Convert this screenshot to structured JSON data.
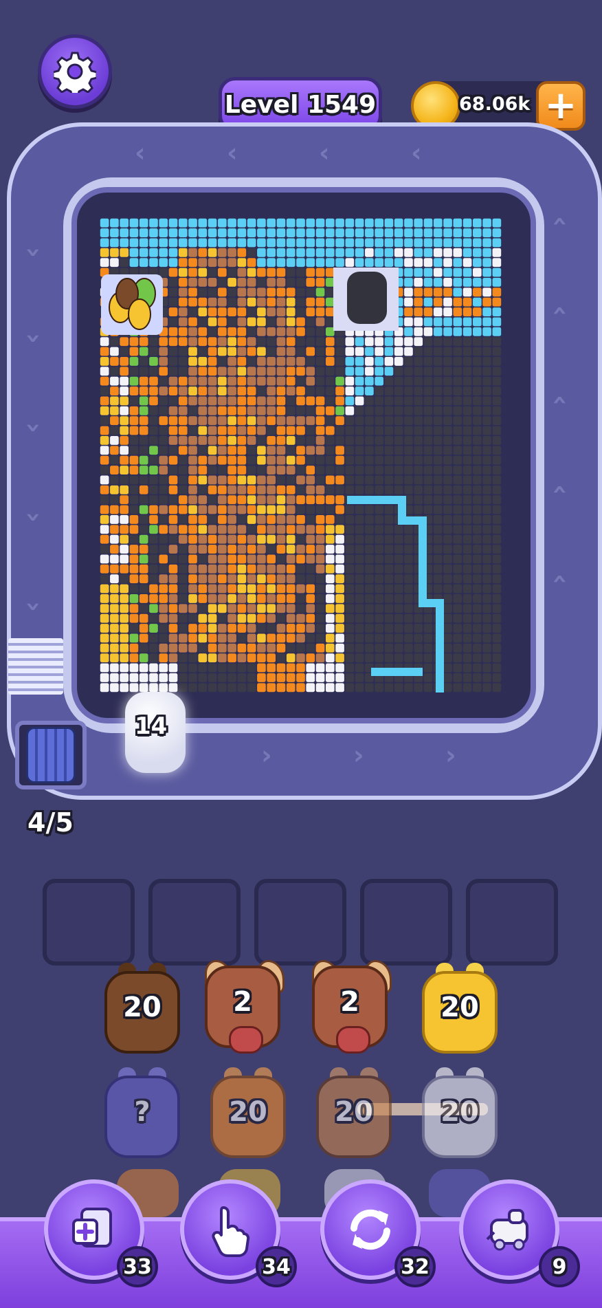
{
  "header": {
    "level_label": "Level 1549",
    "coins": "68.06k"
  },
  "conveyor": {
    "capacity": "4/5",
    "active_collector_count": "14"
  },
  "queue": {
    "row1": [
      {
        "count": "20",
        "color": "#7a4a2a",
        "kind": "pig"
      },
      {
        "count": "2",
        "color": "#a85d42",
        "kind": "bull"
      },
      {
        "count": "2",
        "color": "#a85d42",
        "kind": "bull"
      },
      {
        "count": "20",
        "color": "#f6c430",
        "kind": "pig"
      }
    ],
    "row2": [
      {
        "count": "?",
        "color": "#6a63c9",
        "kind": "pig"
      },
      {
        "count": "20",
        "color": "#f08a2a",
        "kind": "pig"
      },
      {
        "count": "20",
        "color": "#c7834e",
        "kind": "pig"
      },
      {
        "count": "20",
        "color": "#f2f2f8",
        "kind": "pig"
      }
    ]
  },
  "boosters": [
    {
      "name": "add-slot",
      "count": "33"
    },
    {
      "name": "tap",
      "count": "34"
    },
    {
      "name": "shuffle",
      "count": "32"
    },
    {
      "name": "train",
      "count": "9"
    }
  ],
  "colors": {
    "sky": "#5bd0f4",
    "orange": "#f48a1e",
    "brown": "#b7764c",
    "dark": "#3a3a48",
    "white": "#f4f4f8",
    "yellow": "#f6c430",
    "green": "#72c64a",
    "accent": "#7c45e8"
  }
}
